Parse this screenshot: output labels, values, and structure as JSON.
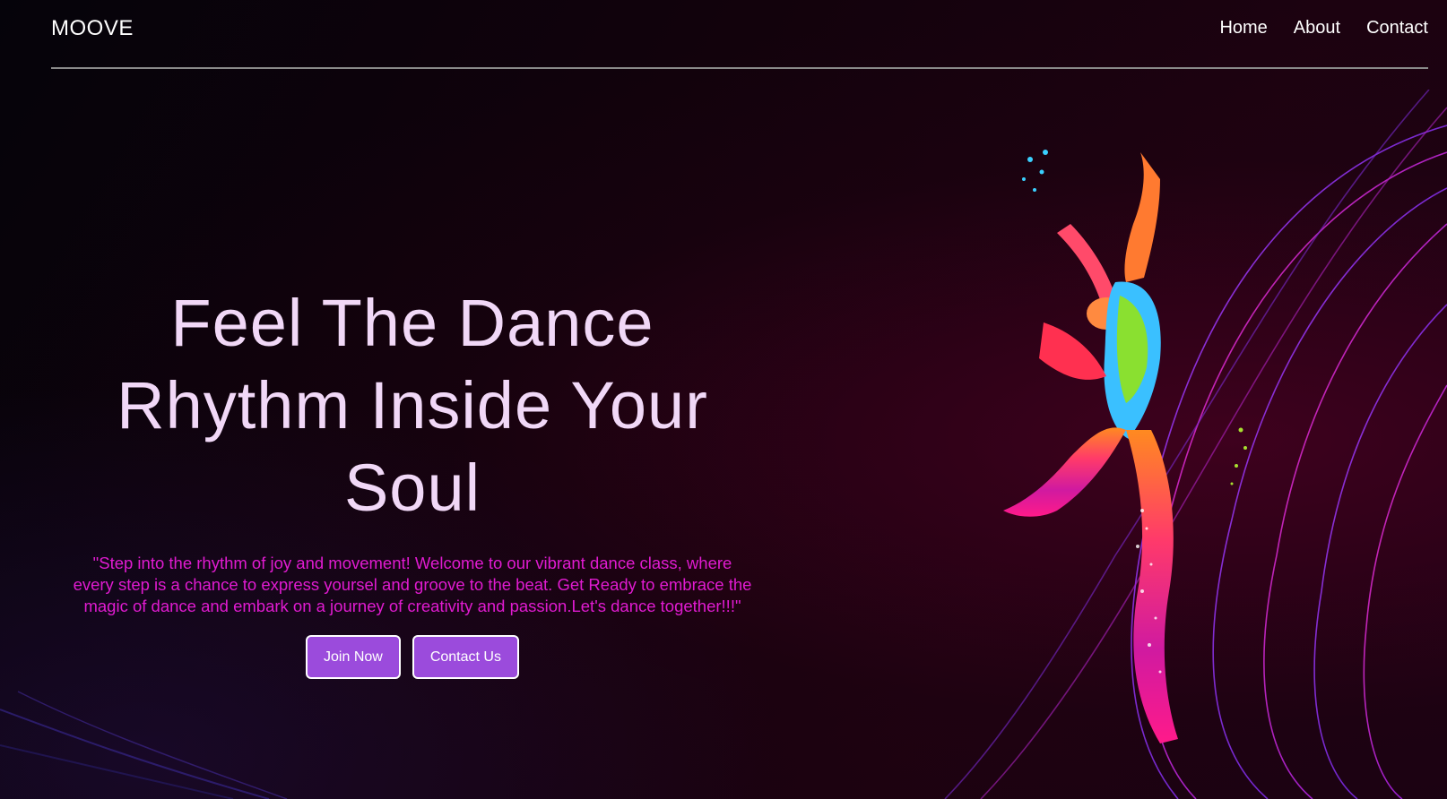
{
  "brand": "MOOVE",
  "nav": {
    "home": "Home",
    "about": "About",
    "contact": "Contact"
  },
  "hero": {
    "title_line1": "Feel The Dance",
    "title_line2": "Rhythm Inside Your",
    "title_line3": "Soul",
    "text": "\"Step into the rhythm of joy and movement! Welcome to our vibrant dance class, where every step is a chance to express yoursel and groove to the beat. Get Ready to embrace the magic of dance and embark on a journey of creativity and passion.Let's dance together!!!\"",
    "join_label": "Join Now",
    "contact_label": "Contact Us"
  },
  "colors": {
    "background": "#140008",
    "title": "#f1d8f7",
    "text": "#e01bd0",
    "button": "#9b4bdc",
    "divider": "#8a8a8a"
  },
  "images": {
    "hero_art": "dancer-silhouette-with-neon-waves"
  }
}
